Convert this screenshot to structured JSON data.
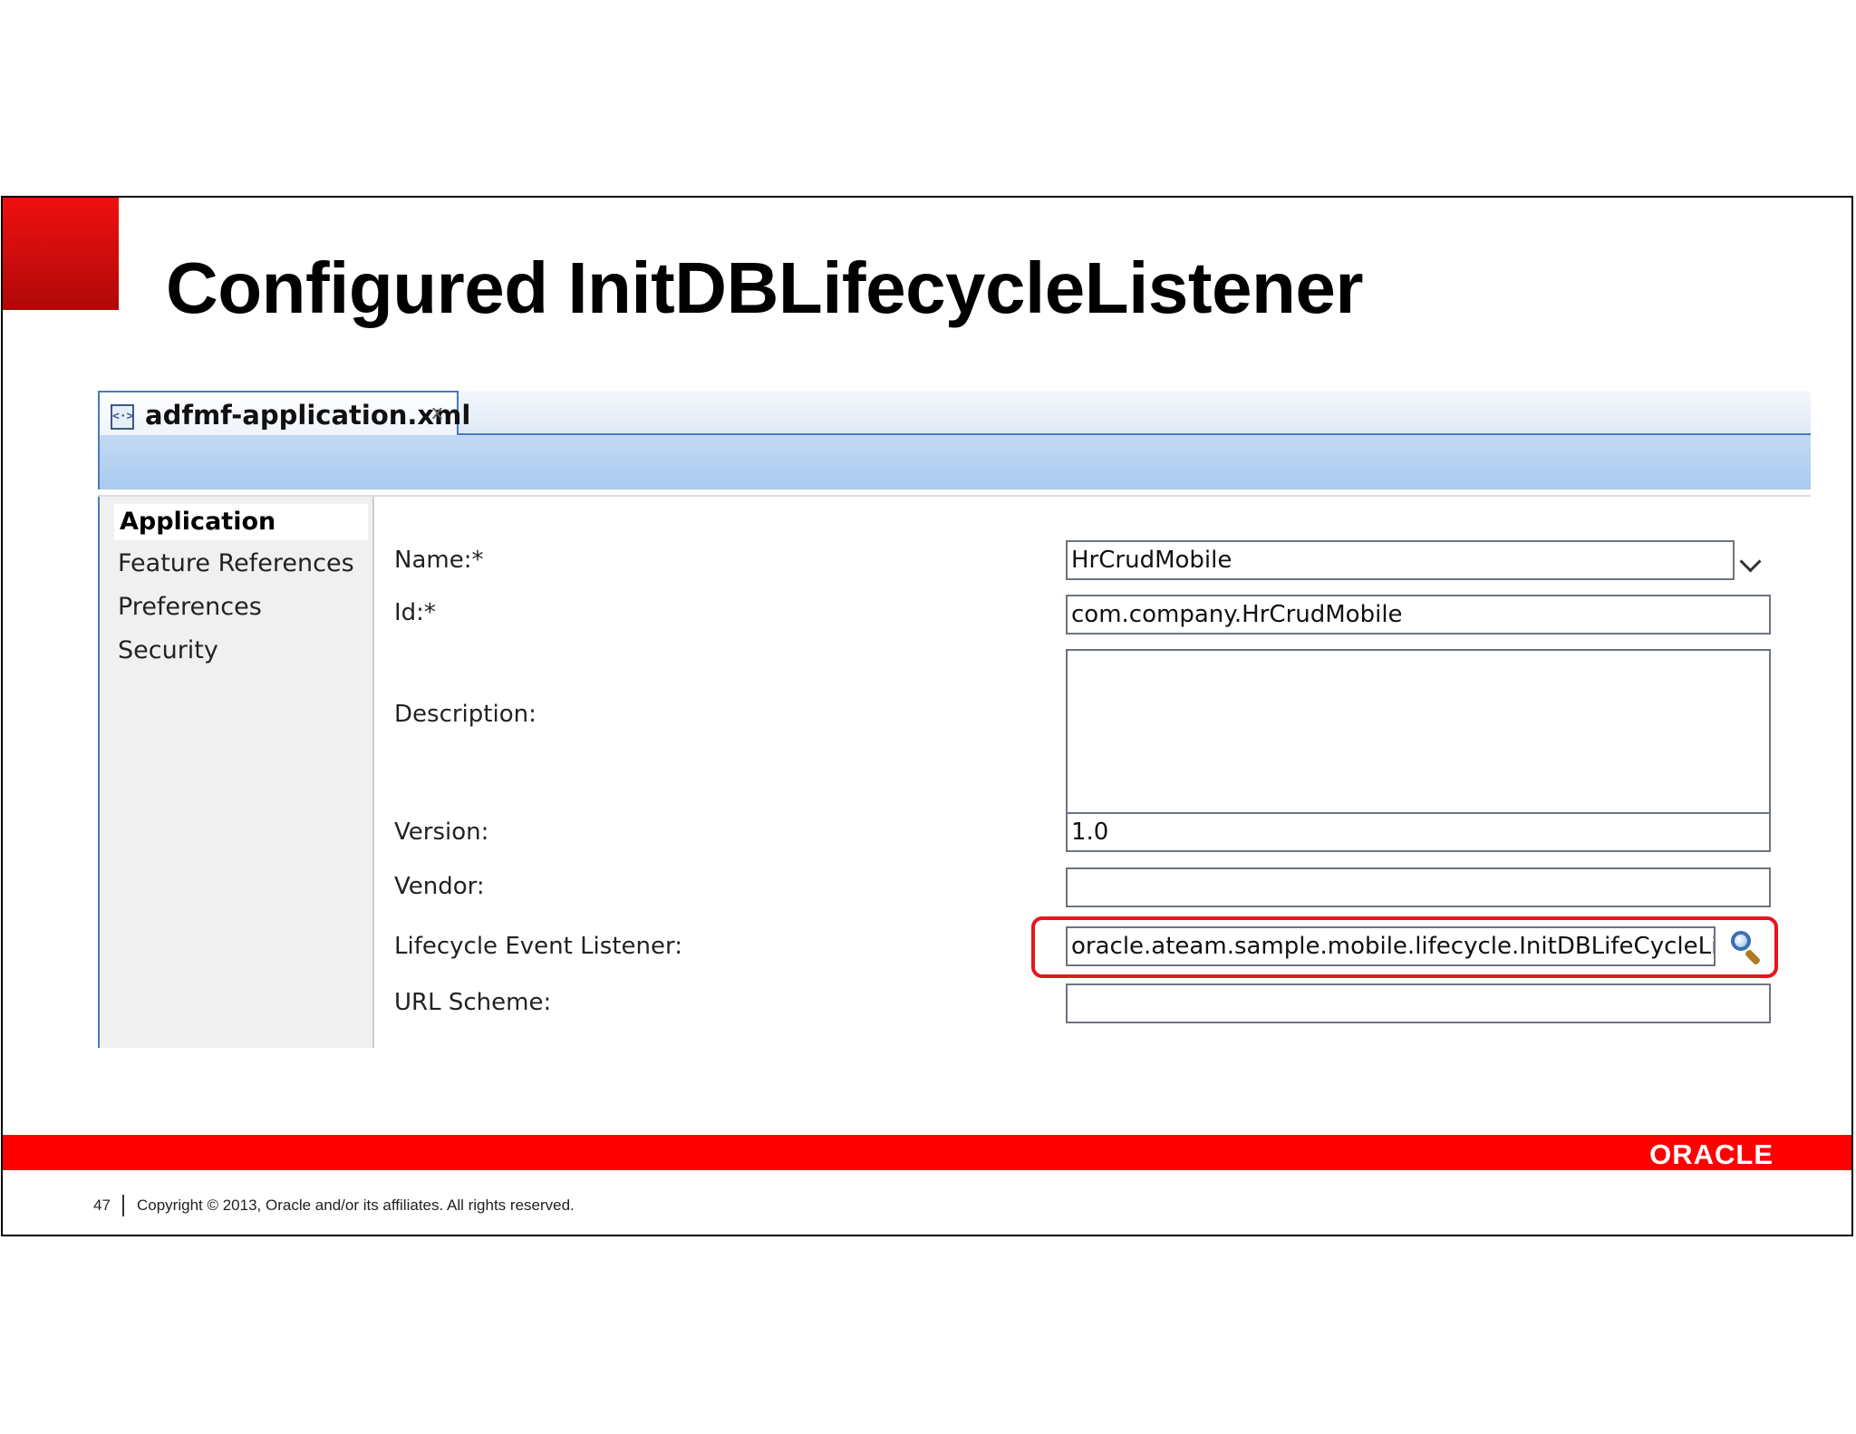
{
  "slide": {
    "title": "Configured InitDBLifecycleListener",
    "page_number": "47",
    "copyright": "Copyright © 2013, Oracle and/or its affiliates. All rights reserved.",
    "logo_text": "ORACLE"
  },
  "editor": {
    "tab_title": "adfmf-application.xml",
    "tab_close": "x",
    "file_icon": "xml-file-icon",
    "file_icon_glyph": "<·>"
  },
  "sidebar": {
    "items": [
      {
        "label": "Application",
        "active": true
      },
      {
        "label": "Feature References",
        "active": false
      },
      {
        "label": "Preferences",
        "active": false
      },
      {
        "label": "Security",
        "active": false
      }
    ]
  },
  "form": {
    "name_label": "Name:*",
    "name_value": "HrCrudMobile",
    "id_label": "Id:*",
    "id_value": "com.company.HrCrudMobile",
    "description_label": "Description:",
    "description_value": "",
    "version_label": "Version:",
    "version_value": "1.0",
    "vendor_label": "Vendor:",
    "vendor_value": "",
    "lifecycle_label": "Lifecycle Event Listener:",
    "lifecycle_value": "oracle.ateam.sample.mobile.lifecycle.InitDBLifeCycleListener",
    "url_scheme_label": "URL Scheme:",
    "url_scheme_value": ""
  },
  "colors": {
    "accent_red": "#ff0000",
    "highlight_red": "#e8141e",
    "tab_border_blue": "#4a7ab8"
  },
  "icons": {
    "lookup": "magnifier-icon",
    "dropdown": "chevron-down-icon"
  }
}
